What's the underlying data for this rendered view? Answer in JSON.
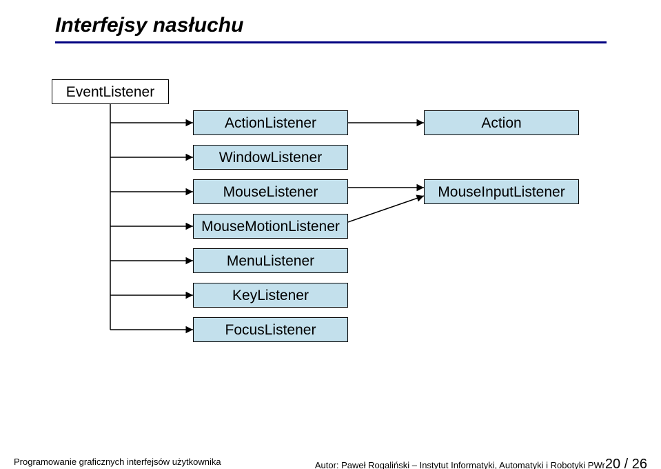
{
  "title": "Interfejsy nasłuchu",
  "root": "EventListener",
  "left_nodes": [
    "ActionListener",
    "WindowListener",
    "MouseListener",
    "MouseMotionListener",
    "MenuListener",
    "KeyListener",
    "FocusListener"
  ],
  "right_nodes": {
    "action": "Action",
    "mouse_input": "MouseInputListener"
  },
  "footer": {
    "left": "Programowanie graficznych interfejsów użytkownika",
    "right_prefix": "Autor: Paweł Rogaliński – Instytut Informatyki, Automatyki i Robotyki PWr",
    "page": "20 / 26"
  },
  "chart_data": {
    "type": "diagram",
    "title": "Interfejsy nasłuchu",
    "nodes": [
      {
        "id": "EventListener",
        "label": "EventListener"
      },
      {
        "id": "ActionListener",
        "label": "ActionListener"
      },
      {
        "id": "WindowListener",
        "label": "WindowListener"
      },
      {
        "id": "MouseListener",
        "label": "MouseListener"
      },
      {
        "id": "MouseMotionListener",
        "label": "MouseMotionListener"
      },
      {
        "id": "MenuListener",
        "label": "MenuListener"
      },
      {
        "id": "KeyListener",
        "label": "KeyListener"
      },
      {
        "id": "FocusListener",
        "label": "FocusListener"
      },
      {
        "id": "Action",
        "label": "Action"
      },
      {
        "id": "MouseInputListener",
        "label": "MouseInputListener"
      }
    ],
    "edges": [
      {
        "from": "EventListener",
        "to": "ActionListener"
      },
      {
        "from": "EventListener",
        "to": "WindowListener"
      },
      {
        "from": "EventListener",
        "to": "MouseListener"
      },
      {
        "from": "EventListener",
        "to": "MouseMotionListener"
      },
      {
        "from": "EventListener",
        "to": "MenuListener"
      },
      {
        "from": "EventListener",
        "to": "KeyListener"
      },
      {
        "from": "EventListener",
        "to": "FocusListener"
      },
      {
        "from": "ActionListener",
        "to": "Action"
      },
      {
        "from": "MouseListener",
        "to": "MouseInputListener"
      },
      {
        "from": "MouseMotionListener",
        "to": "MouseInputListener"
      }
    ]
  }
}
